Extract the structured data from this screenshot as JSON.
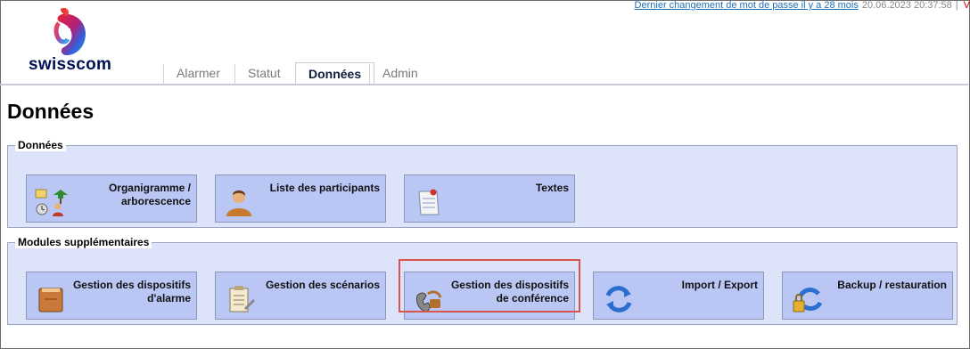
{
  "topbar": {
    "password_link": "Dernier changement de mot de passe il y a 28 mois",
    "timestamp": "20.06.2023 20:37:58",
    "separator": "|",
    "extra": "V"
  },
  "brand": {
    "name": "swisscom"
  },
  "tabs": [
    {
      "label": "Alarmer"
    },
    {
      "label": "Statut"
    },
    {
      "label": "Données",
      "active": true
    },
    {
      "label": "Admin"
    }
  ],
  "page": {
    "title": "Données"
  },
  "sections": [
    {
      "legend": "Données",
      "tiles": [
        {
          "label": "Organigramme / arborescence",
          "icon": "organigram-icon"
        },
        {
          "label": "Liste des participants",
          "icon": "participants-icon"
        },
        {
          "label": "Textes",
          "icon": "texts-icon"
        }
      ]
    },
    {
      "legend": "Modules supplémentaires",
      "tiles": [
        {
          "label": "Gestion des dispositifs d'alarme",
          "icon": "alarm-devices-icon"
        },
        {
          "label": "Gestion des scénarios",
          "icon": "scenarios-icon"
        },
        {
          "label": "Gestion des dispositifs de conférence",
          "icon": "conference-devices-icon"
        },
        {
          "label": "Import / Export",
          "icon": "import-export-icon"
        },
        {
          "label": "Backup / restauration",
          "icon": "backup-restore-icon"
        }
      ]
    }
  ],
  "colors": {
    "tile_bg": "#bac7f4",
    "fieldset_bg": "#dde3f8",
    "link": "#1f6fb5",
    "highlight": "#d9534f",
    "brand_text": "#001155"
  }
}
